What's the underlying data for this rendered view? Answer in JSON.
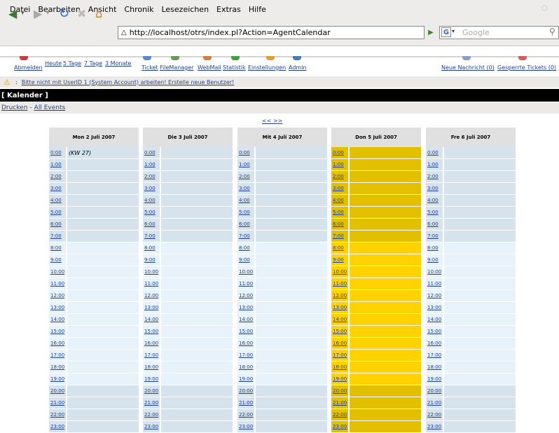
{
  "menubar": {
    "items": [
      "Datei",
      "Bearbeiten",
      "Ansicht",
      "Chronik",
      "Lesezeichen",
      "Extras",
      "Hilfe"
    ]
  },
  "urlbar": {
    "url": "http://localhost/otrs/index.pl?Action=AgentCalendar"
  },
  "search": {
    "placeholder": "Google"
  },
  "otrs_nav": {
    "logout": "Abmelden",
    "today": "Heute",
    "days5": "5 Tage",
    "days7": "7 Tage",
    "months3": "3 Monate",
    "ticket": "Ticket",
    "filemanager": "FileManager",
    "webmail": "WebMail",
    "statistik": "Statistik",
    "einstellungen": "Einstellungen",
    "admin": "Admin",
    "new_messages": "Neue Nachricht (0)",
    "locked_tickets": "Gesperrte Tickets (0)"
  },
  "warning": {
    "prefix": ":",
    "text": "Bitte nicht mit UserID 1 (System Account) arbeiten! Erstelle neue Benutzer!"
  },
  "title": "[ Kalender ]",
  "printbar": {
    "print": "Drucken",
    "sep": "-",
    "all_events": "All Events"
  },
  "pager": "<< >>",
  "calendar": {
    "days": [
      {
        "label": "Mon 2 Juli 2007"
      },
      {
        "label": "Die 3 Juli 2007"
      },
      {
        "label": "Mit 4 Juli 2007"
      },
      {
        "label": "Don 5 Juli 2007"
      },
      {
        "label": "Fre 6 Juli 2007"
      }
    ],
    "hours": [
      "0:00",
      "1:00",
      "2:00",
      "3:00",
      "4:00",
      "5:00",
      "6:00",
      "7:00",
      "8:00",
      "9:00",
      "10:00",
      "11:00",
      "12:00",
      "13:00",
      "14:00",
      "15:00",
      "16:00",
      "17:00",
      "18:00",
      "19:00",
      "20:00",
      "21:00",
      "22:00",
      "23:00"
    ],
    "week_note": "(KW 27)",
    "highlight_day": "Don 5 Juli 2007"
  },
  "colors": {
    "row_off": "#d6e2ec",
    "row_work": "#e8f2fa",
    "today_off": "#e2c000",
    "today_work": "#ffd200",
    "link": "#1f3f8f"
  }
}
